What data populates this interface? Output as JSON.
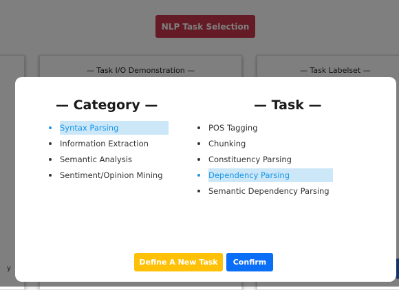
{
  "background": {
    "nlp_button_label": "NLP Task Selection",
    "panel_io_title": "— Task I/O Demonstration —",
    "panel_labelset_title": "— Task Labelset —",
    "left_edge_text": "y"
  },
  "modal": {
    "category": {
      "title": "— Category —",
      "items": [
        {
          "label": "Syntax Parsing",
          "selected": true
        },
        {
          "label": "Information Extraction",
          "selected": false
        },
        {
          "label": "Semantic Analysis",
          "selected": false
        },
        {
          "label": "Sentiment/Opinion Mining",
          "selected": false
        }
      ]
    },
    "task": {
      "title": "— Task —",
      "items": [
        {
          "label": "POS Tagging",
          "selected": false
        },
        {
          "label": "Chunking",
          "selected": false
        },
        {
          "label": "Constituency Parsing",
          "selected": false
        },
        {
          "label": "Dependency Parsing",
          "selected": true
        },
        {
          "label": "Semantic Dependency Parsing",
          "selected": false
        }
      ]
    },
    "define_button_label": "Define A New Task",
    "confirm_button_label": "Confirm"
  },
  "colors": {
    "nlp_button": "#c9364a",
    "selected_text": "#1896e8",
    "selected_highlight": "#cce7f8",
    "define_button": "#ffc107",
    "confirm_button": "#0a6ef7"
  }
}
